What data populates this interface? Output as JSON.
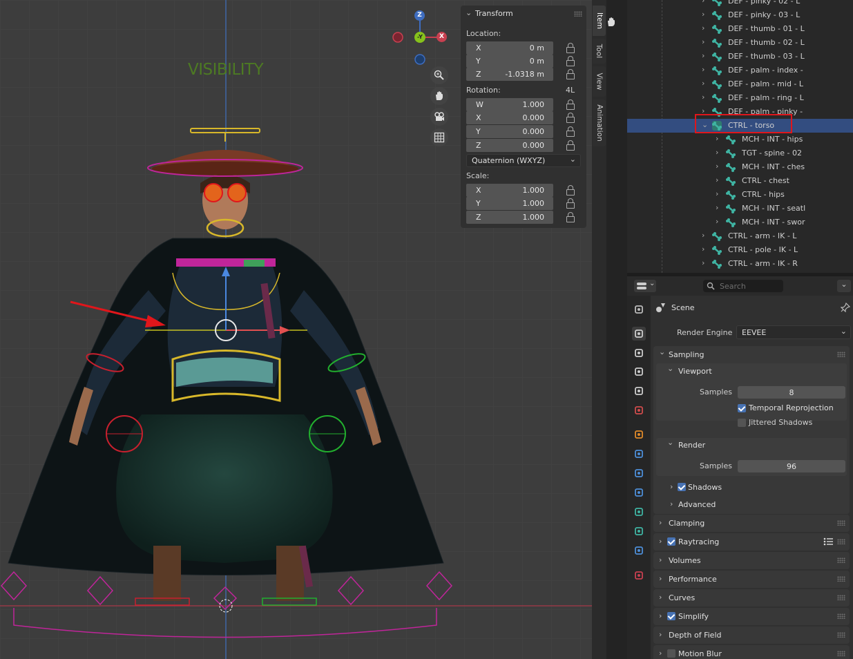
{
  "viewport": {
    "overlay_text": "VISIBILITY",
    "gizmo": {
      "z": "Z",
      "neg_y": "-Y",
      "x": "X"
    },
    "nav_icons": [
      "zoom-icon",
      "hand-pan-icon",
      "camera-icon",
      "grid-icon"
    ]
  },
  "npanel": {
    "tabs": [
      "Item",
      "Tool",
      "View",
      "Animation"
    ],
    "active_tab": "Item",
    "transform": {
      "title": "Transform",
      "location_label": "Location:",
      "location": [
        {
          "axis": "X",
          "value": "0 m"
        },
        {
          "axis": "Y",
          "value": "0 m"
        },
        {
          "axis": "Z",
          "value": "-1.0318 m"
        }
      ],
      "rotation_label": "Rotation:",
      "rotation_mode_short": "4L",
      "rotation": [
        {
          "axis": "W",
          "value": "1.000"
        },
        {
          "axis": "X",
          "value": "0.000"
        },
        {
          "axis": "Y",
          "value": "0.000"
        },
        {
          "axis": "Z",
          "value": "0.000"
        }
      ],
      "rotation_mode": "Quaternion (WXYZ)",
      "scale_label": "Scale:",
      "scale": [
        {
          "axis": "X",
          "value": "1.000"
        },
        {
          "axis": "Y",
          "value": "1.000"
        },
        {
          "axis": "Z",
          "value": "1.000"
        }
      ]
    }
  },
  "outliner": {
    "rows": [
      {
        "label": "DEF - pinky - 02 - L",
        "indent": 1,
        "selected": false
      },
      {
        "label": "DEF - pinky - 03 - L",
        "indent": 1,
        "selected": false
      },
      {
        "label": "DEF - thumb - 01 - L",
        "indent": 1,
        "selected": false
      },
      {
        "label": "DEF - thumb - 02 - L",
        "indent": 1,
        "selected": false
      },
      {
        "label": "DEF - thumb - 03 - L",
        "indent": 1,
        "selected": false
      },
      {
        "label": "DEF - palm - index -",
        "indent": 1,
        "selected": false
      },
      {
        "label": "DEF - palm - mid - L",
        "indent": 1,
        "selected": false
      },
      {
        "label": "DEF - palm - ring - L",
        "indent": 1,
        "selected": false
      },
      {
        "label": "DEF - palm - pinky -",
        "indent": 1,
        "selected": false
      },
      {
        "label": "CTRL - torso",
        "indent": 1,
        "selected": true,
        "expanded": true
      },
      {
        "label": "MCH - INT - hips",
        "indent": 2,
        "selected": false
      },
      {
        "label": "TGT - spine - 02",
        "indent": 2,
        "selected": false
      },
      {
        "label": "MCH - INT - ches",
        "indent": 2,
        "selected": false
      },
      {
        "label": "CTRL - chest",
        "indent": 2,
        "selected": false
      },
      {
        "label": "CTRL - hips",
        "indent": 2,
        "selected": false
      },
      {
        "label": "MCH - INT - seatl",
        "indent": 2,
        "selected": false
      },
      {
        "label": "MCH - INT - swor",
        "indent": 2,
        "selected": false
      },
      {
        "label": "CTRL - arm - IK - L",
        "indent": 1,
        "selected": false
      },
      {
        "label": "CTRL - pole - IK - L",
        "indent": 1,
        "selected": false
      },
      {
        "label": "CTRL - arm - IK - R",
        "indent": 1,
        "selected": false
      }
    ]
  },
  "properties": {
    "search_placeholder": "Search",
    "context": "Scene",
    "render_engine_label": "Render Engine",
    "render_engine": "EEVEE",
    "sampling": {
      "title": "Sampling",
      "viewport_title": "Viewport",
      "viewport_samples_label": "Samples",
      "viewport_samples": "8",
      "temporal_reprojection": "Temporal Reprojection",
      "temporal_reprojection_on": true,
      "jittered_shadows": "Jittered Shadows",
      "jittered_shadows_on": false,
      "render_title": "Render",
      "render_samples_label": "Samples",
      "render_samples": "96",
      "shadows": "Shadows",
      "shadows_on": true,
      "advanced": "Advanced"
    },
    "panels": [
      {
        "title": "Clamping",
        "checkbox": null
      },
      {
        "title": "Raytracing",
        "checkbox": true
      },
      {
        "title": "Volumes",
        "checkbox": null
      },
      {
        "title": "Performance",
        "checkbox": null
      },
      {
        "title": "Curves",
        "checkbox": null
      },
      {
        "title": "Simplify",
        "checkbox": true
      },
      {
        "title": "Depth of Field",
        "checkbox": null
      },
      {
        "title": "Motion Blur",
        "checkbox": false
      }
    ],
    "tab_icons": [
      "tool-icon",
      "render-icon",
      "output-icon",
      "view-layer-icon",
      "scene-icon",
      "world-icon",
      "object-icon",
      "modifier-icon",
      "particles-icon",
      "physics-icon",
      "armature-data-icon",
      "bone-icon",
      "bone-constraint-icon",
      "texture-icon"
    ]
  },
  "colors": {
    "selection_blue": "#334d80",
    "checkbox_blue": "#4772b3",
    "highlight_red": "#e0161b",
    "bone_teal": "#3fb4a3",
    "rig_magenta": "#c0259a"
  }
}
